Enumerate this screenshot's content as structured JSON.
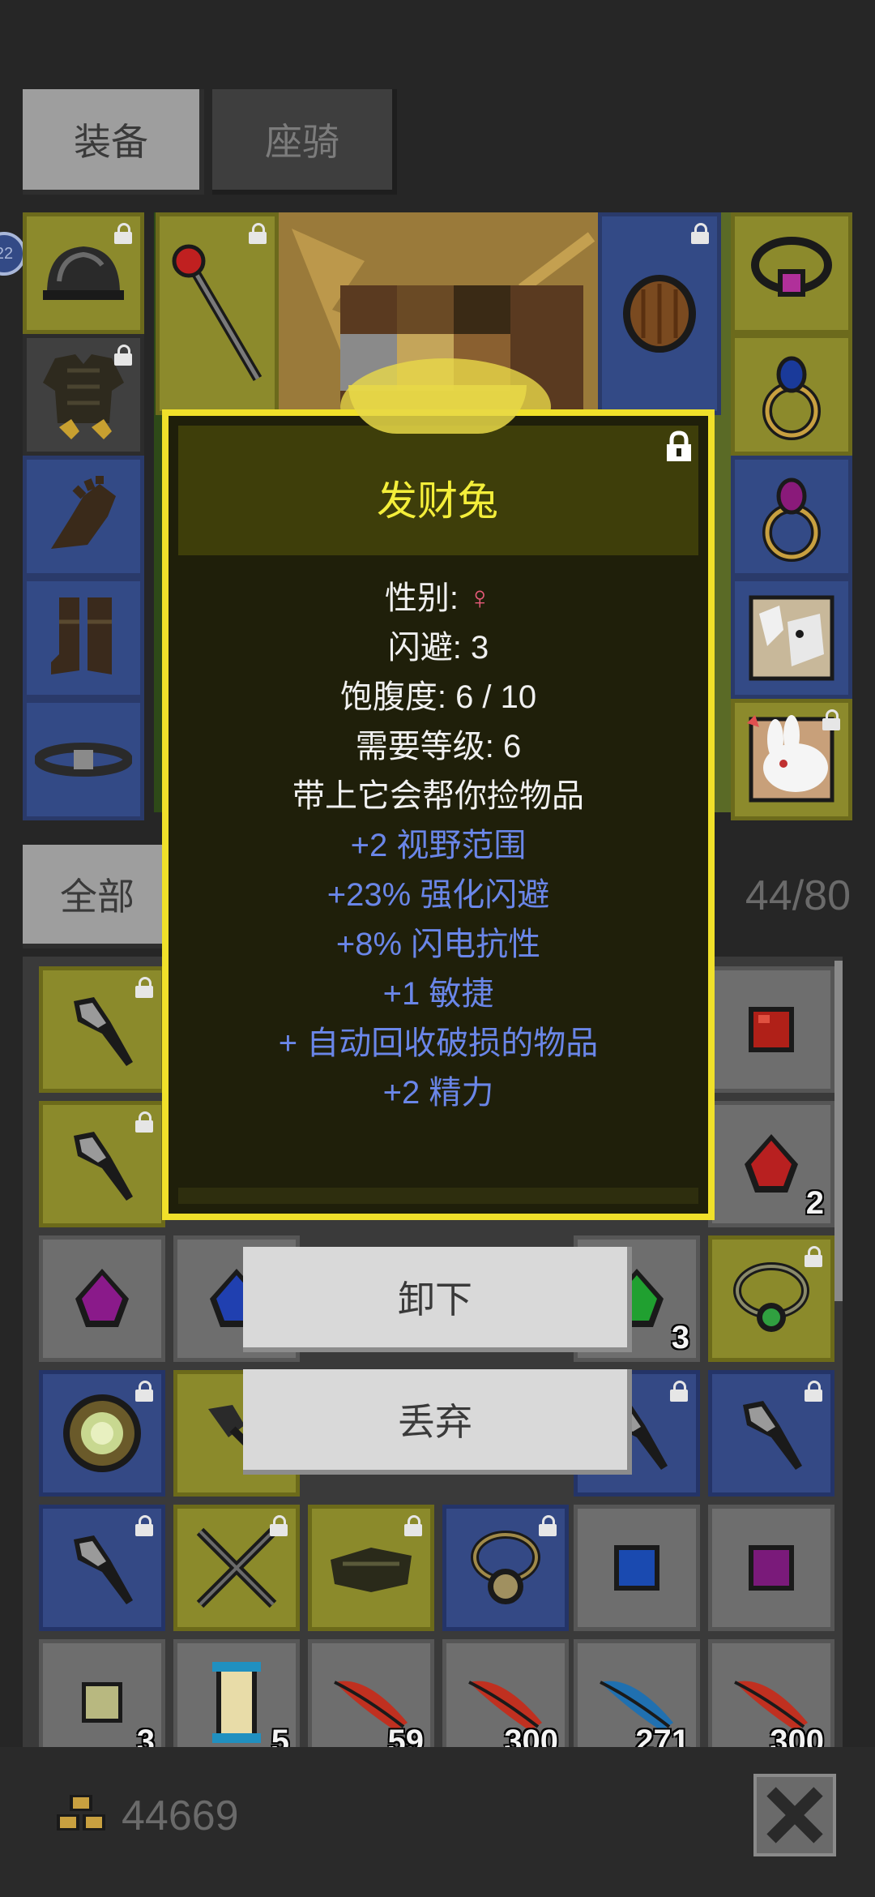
{
  "tabs": {
    "equipment": "装备",
    "mount": "座骑"
  },
  "filter": {
    "label": "全部",
    "capacity": "44/80"
  },
  "side_badge": "22",
  "pet": {
    "name": "发财兔",
    "gender_label": "性别: ",
    "gender_symbol": "♀",
    "evasion": "闪避: 3",
    "satiety": "饱腹度: 6 / 10",
    "required_level": "需要等级: 6",
    "description": "带上它会帮你捡物品",
    "bonuses": [
      "+2 视野范围",
      "+23% 强化闪避",
      "+8% 闪电抗性",
      "+1 敏捷",
      "+ 自动回收破损的物品",
      "+2 精力"
    ]
  },
  "actions": {
    "unequip": "卸下",
    "discard": "丢弃"
  },
  "inventory_counts": {
    "r2c6": "2",
    "r3c5": "3",
    "r6c1": "3",
    "r6c2": "5",
    "r6c3": "59",
    "r6c4": "300",
    "r6c5": "271",
    "r6c6": "300"
  },
  "gold": "44669"
}
